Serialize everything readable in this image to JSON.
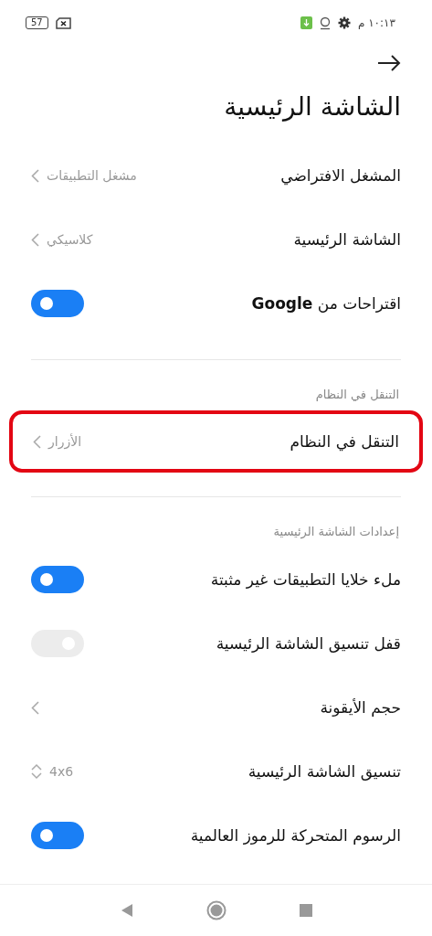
{
  "status_bar": {
    "time": "١٠:١٣ م",
    "battery": "57"
  },
  "title": "الشاشة الرئيسية",
  "sections": [
    {
      "rows": [
        {
          "kind": "link",
          "label": "المشغل الافتراضي",
          "value": "مشغل التطبيقات",
          "highlighted": false
        },
        {
          "kind": "link",
          "label": "الشاشة الرئيسية",
          "value": "كلاسيكي",
          "highlighted": false
        },
        {
          "kind": "toggle",
          "label": "اقتراحات من **Google**",
          "on": true,
          "disabled": false,
          "highlighted": false
        }
      ]
    },
    {
      "header": "التنقل في النظام",
      "rows": [
        {
          "kind": "link",
          "label": "التنقل في النظام",
          "value": "الأزرار",
          "highlighted": true
        }
      ]
    },
    {
      "header": "إعدادات الشاشة الرئيسية",
      "rows": [
        {
          "kind": "toggle",
          "label": "ملء خلايا التطبيقات غير مثبتة",
          "on": true,
          "disabled": false,
          "highlighted": false
        },
        {
          "kind": "toggle",
          "label": "قفل تنسيق الشاشة الرئيسية",
          "on": false,
          "disabled": true,
          "highlighted": false
        },
        {
          "kind": "link",
          "label": "حجم الأيقونة",
          "highlighted": false
        },
        {
          "kind": "stepper",
          "label": "تنسيق الشاشة الرئيسية",
          "value": "4x6",
          "highlighted": false
        },
        {
          "kind": "toggle",
          "label": "الرسوم المتحركة للرموز العالمية",
          "on": true,
          "disabled": false,
          "highlighted": false
        }
      ]
    }
  ]
}
